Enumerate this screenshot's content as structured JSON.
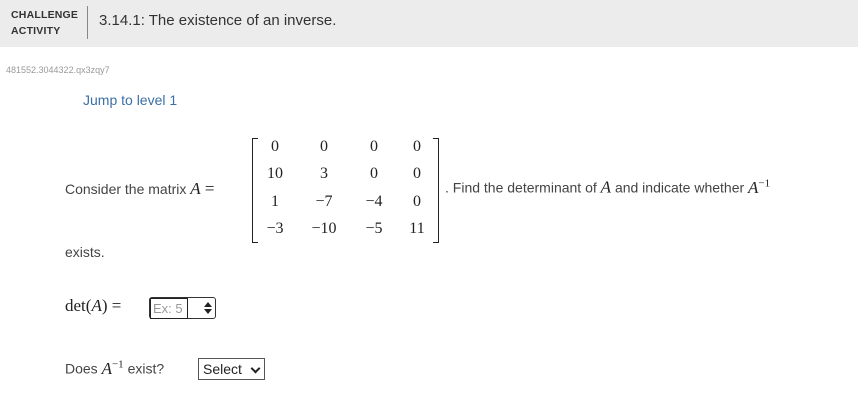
{
  "header": {
    "label_line1": "CHALLENGE",
    "label_line2": "ACTIVITY",
    "title": "3.14.1: The existence of an inverse."
  },
  "activity_code": "481552.3044322.qx3zqy7",
  "jump_link": "Jump to level 1",
  "question": {
    "prefix": "Consider the matrix",
    "matrix_var": "A",
    "equals": "=",
    "matrix": [
      [
        "0",
        "0",
        "0",
        "0"
      ],
      [
        "10",
        "3",
        "0",
        "0"
      ],
      [
        "1",
        "−7",
        "−4",
        "0"
      ],
      [
        "−3",
        "−10",
        "−5",
        "11"
      ]
    ],
    "find_text": ". Find the determinant of",
    "find_var": "A",
    "indicate_text": "and indicate whether",
    "inverse_var": "A",
    "inverse_exp": "−1",
    "tail": "exists."
  },
  "det": {
    "label_fn": "det",
    "label_var": "A",
    "equals": "=",
    "input_placeholder": "Ex: 5"
  },
  "inverse_question": {
    "prefix": "Does",
    "var": "A",
    "exp": "−1",
    "suffix": "exist?",
    "select_value": "Select"
  }
}
